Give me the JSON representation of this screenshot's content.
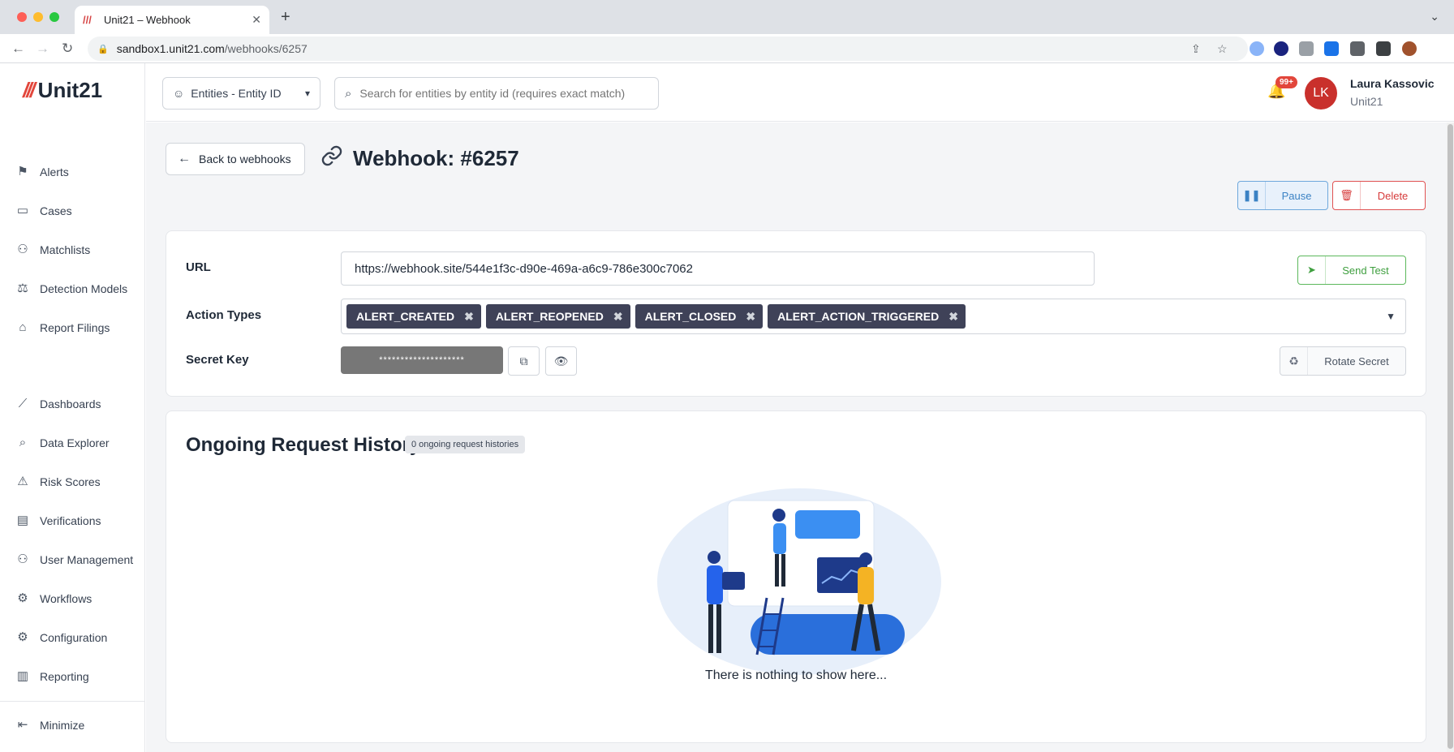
{
  "browser": {
    "tab_title": "Unit21 – Webhook",
    "url_domain": "sandbox1.unit21.com",
    "url_path": "/webhooks/6257"
  },
  "brand": {
    "name": "Unit21",
    "accent": "#e2463b"
  },
  "sidebar": {
    "items": [
      {
        "label": "Alerts",
        "icon": "flag-icon"
      },
      {
        "label": "Cases",
        "icon": "briefcase-icon"
      },
      {
        "label": "Matchlists",
        "icon": "user-x-icon"
      },
      {
        "label": "Detection Models",
        "icon": "scale-icon"
      },
      {
        "label": "Report Filings",
        "icon": "bank-icon"
      },
      {
        "label": "Dashboards",
        "icon": "chart-line-icon"
      },
      {
        "label": "Data Explorer",
        "icon": "search-data-icon"
      },
      {
        "label": "Risk Scores",
        "icon": "warning-icon"
      },
      {
        "label": "Verifications",
        "icon": "id-card-icon"
      },
      {
        "label": "User Management",
        "icon": "users-icon"
      },
      {
        "label": "Workflows",
        "icon": "workflow-gear-icon"
      },
      {
        "label": "Configuration",
        "icon": "gear-icon"
      },
      {
        "label": "Reporting",
        "icon": "report-icon"
      }
    ],
    "minimize_label": "Minimize"
  },
  "topbar": {
    "entity_select_label": "Entities - Entity ID",
    "search_placeholder": "Search for entities by entity id (requires exact match)",
    "notification_count": "99+",
    "user": {
      "initials": "LK",
      "name": "Laura Kassovic",
      "org": "Unit21"
    }
  },
  "page": {
    "back_label": "Back to webhooks",
    "title": "Webhook: #6257",
    "pause_label": "Pause",
    "delete_label": "Delete"
  },
  "form": {
    "url_label": "URL",
    "url_value": "https://webhook.site/544e1f3c-d90e-469a-a6c9-786e300c7062",
    "send_test_label": "Send Test",
    "action_types_label": "Action Types",
    "action_types": [
      "ALERT_CREATED",
      "ALERT_REOPENED",
      "ALERT_CLOSED",
      "ALERT_ACTION_TRIGGERED"
    ],
    "secret_key_label": "Secret Key",
    "secret_key_masked": "********************",
    "rotate_secret_label": "Rotate Secret"
  },
  "history": {
    "title": "Ongoing Request History",
    "badge": "0 ongoing request histories",
    "empty_text": "There is nothing to show here..."
  }
}
